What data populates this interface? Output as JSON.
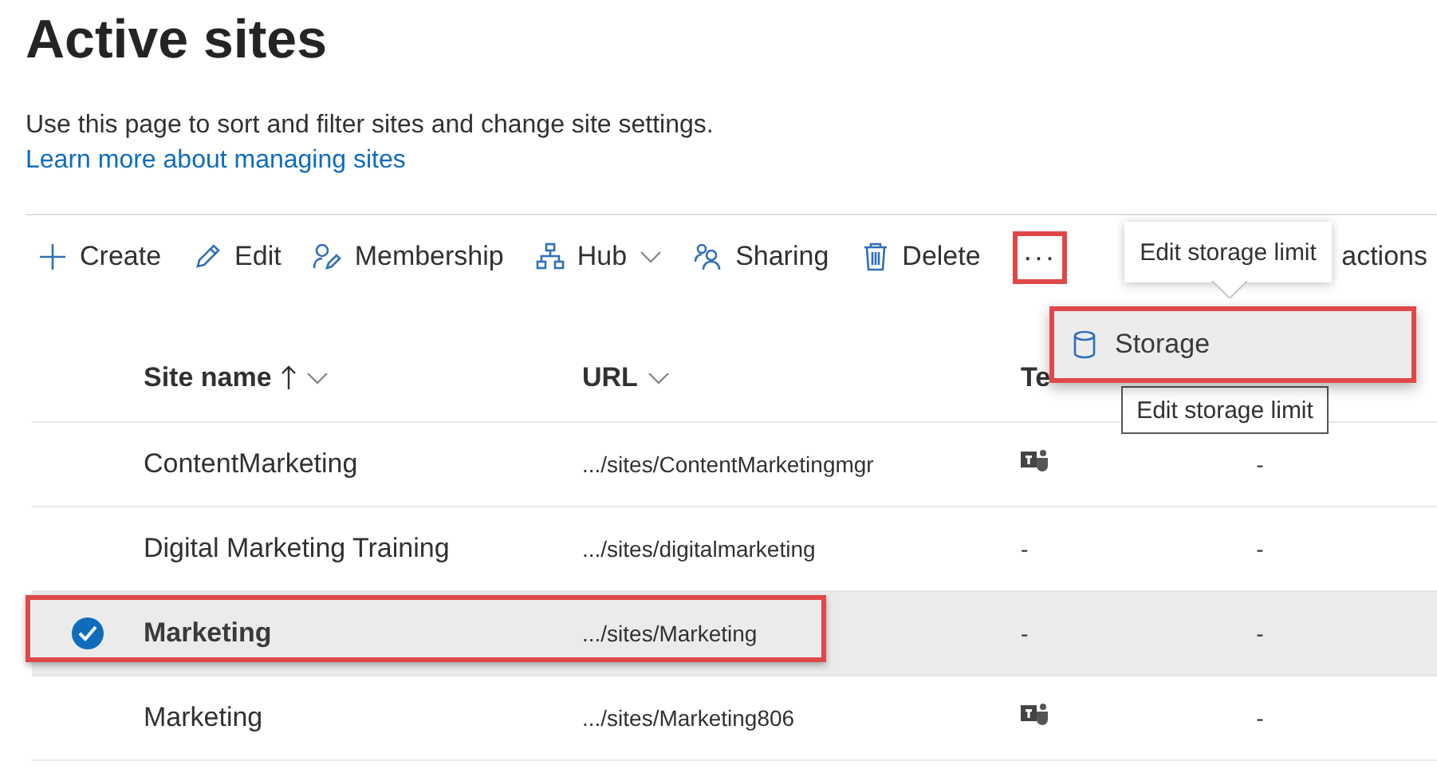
{
  "page": {
    "title": "Active sites",
    "description": "Use this page to sort and filter sites and change site settings.",
    "link": "Learn more about managing sites"
  },
  "toolbar": {
    "items": [
      {
        "label": "Create",
        "dropdown": false
      },
      {
        "label": "Edit",
        "dropdown": false
      },
      {
        "label": "Membership",
        "dropdown": false
      },
      {
        "label": "Hub",
        "dropdown": true
      },
      {
        "label": "Sharing",
        "dropdown": false
      },
      {
        "label": "Delete",
        "dropdown": false
      }
    ],
    "more_button": {
      "label": "···",
      "highlighted": true
    },
    "trailing_text": "actions"
  },
  "table": {
    "columns": [
      {
        "label": "Site name",
        "sorted": true,
        "dropdown": true
      },
      {
        "label": "URL",
        "sorted": false,
        "dropdown": true
      },
      {
        "label": "Te",
        "sorted": false,
        "dropdown": false
      }
    ],
    "rows": [
      {
        "site_name": "ContentMarketing",
        "url": ".../sites/ContentMarketingmgr",
        "teams": {
          "kind": "icon"
        },
        "column_4": "-",
        "selected": false,
        "highlighted": false
      },
      {
        "site_name": "Digital Marketing Training",
        "url": ".../sites/digitalmarketing",
        "teams": {
          "kind": "text",
          "text": "-"
        },
        "column_4": "-",
        "selected": false,
        "highlighted": false
      },
      {
        "site_name": "Marketing",
        "url": ".../sites/Marketing",
        "teams": {
          "kind": "text",
          "text": "-"
        },
        "column_4": "-",
        "selected": true,
        "highlighted": true
      },
      {
        "site_name": "Marketing",
        "url": ".../sites/Marketing806",
        "teams": {
          "kind": "icon"
        },
        "column_4": "-",
        "selected": false,
        "highlighted": false
      }
    ]
  },
  "menu": {
    "items": [
      {
        "label": "Storage",
        "highlighted": true
      }
    ]
  },
  "tooltips": [
    "Edit storage limit",
    "Edit storage limit"
  ]
}
